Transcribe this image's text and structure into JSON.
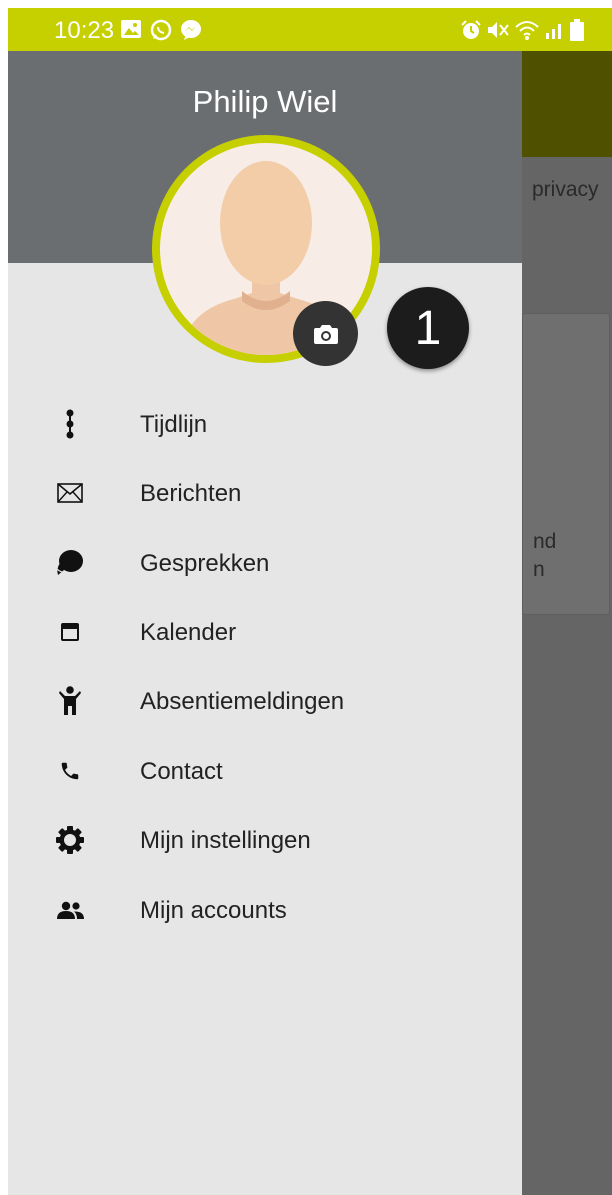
{
  "status_bar": {
    "time": "10:23"
  },
  "drawer": {
    "user_name": "Philip Wiel",
    "badge_number": "1",
    "items": [
      {
        "label": "Tijdlijn",
        "icon": "timeline-icon"
      },
      {
        "label": "Berichten",
        "icon": "envelope-icon"
      },
      {
        "label": "Gesprekken",
        "icon": "chat-bubbles-icon"
      },
      {
        "label": "Kalender",
        "icon": "calendar-icon"
      },
      {
        "label": "Absentiemeldingen",
        "icon": "child-icon"
      },
      {
        "label": "Contact",
        "icon": "phone-icon"
      },
      {
        "label": "Mijn instellingen",
        "icon": "gear-icon"
      },
      {
        "label": "Mijn accounts",
        "icon": "people-icon"
      }
    ]
  },
  "background": {
    "privacy_text": "privacy",
    "card_line1": "nd",
    "card_line2": "n"
  },
  "colors": {
    "accent": "#c6cf00",
    "header": "#6b6e70",
    "drawer_bg": "#e6e6e6",
    "scrim": "#656565"
  }
}
